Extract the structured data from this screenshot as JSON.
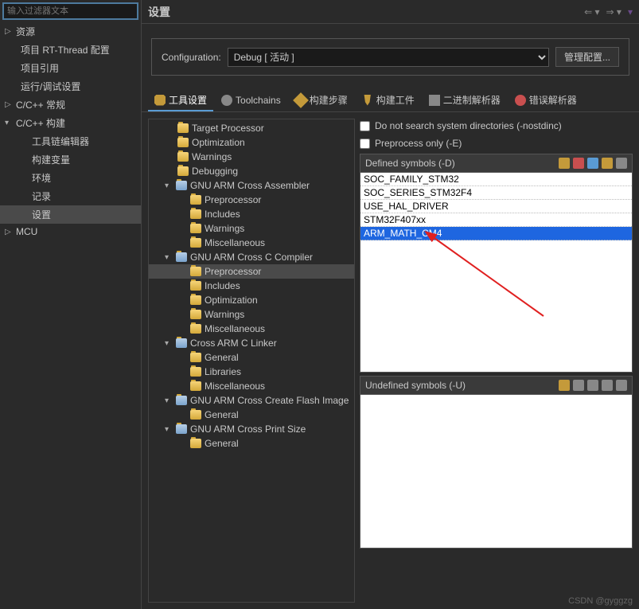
{
  "filter_placeholder": "输入过滤器文本",
  "nav": {
    "resources": "资源",
    "rt_thread": "项目 RT-Thread 配置",
    "refs": "项目引用",
    "run_debug": "运行/调试设置",
    "cpp_general": "C/C++ 常规",
    "cpp_build": "C/C++ 构建",
    "toolchain_editor": "工具链编辑器",
    "build_vars": "构建变量",
    "env": "环境",
    "logging": "记录",
    "settings": "设置",
    "mcu": "MCU"
  },
  "header": {
    "title": "设置"
  },
  "config": {
    "label": "Configuration:",
    "selected": "Debug  [ 活动 ]",
    "manage": "管理配置..."
  },
  "tabs": {
    "tool_settings": "工具设置",
    "toolchains": "Toolchains",
    "build_steps": "构建步骤",
    "build_artifacts": "构建工件",
    "binary_parsers": "二进制解析器",
    "error_parsers": "错误解析器"
  },
  "tree": {
    "target_processor": "Target Processor",
    "optimization": "Optimization",
    "warnings": "Warnings",
    "debugging": "Debugging",
    "gnu_asm": "GNU ARM Cross Assembler",
    "preprocessor": "Preprocessor",
    "includes": "Includes",
    "miscellaneous": "Miscellaneous",
    "gnu_c": "GNU ARM Cross C Compiler",
    "gnu_linker": "Cross ARM C Linker",
    "general": "General",
    "libraries": "Libraries",
    "gnu_flash": "GNU ARM Cross Create Flash Image",
    "gnu_print": "GNU ARM Cross Print Size"
  },
  "options": {
    "nostdinc": "Do not search system directories (-nostdinc)",
    "preprocess_only": "Preprocess only (-E)"
  },
  "defined": {
    "title": "Defined symbols (-D)",
    "items": [
      "SOC_FAMILY_STM32",
      "SOC_SERIES_STM32F4",
      "USE_HAL_DRIVER",
      "STM32F407xx",
      "ARM_MATH_CM4"
    ]
  },
  "undefined": {
    "title": "Undefined symbols (-U)"
  },
  "watermark": "CSDN @gyggzg"
}
